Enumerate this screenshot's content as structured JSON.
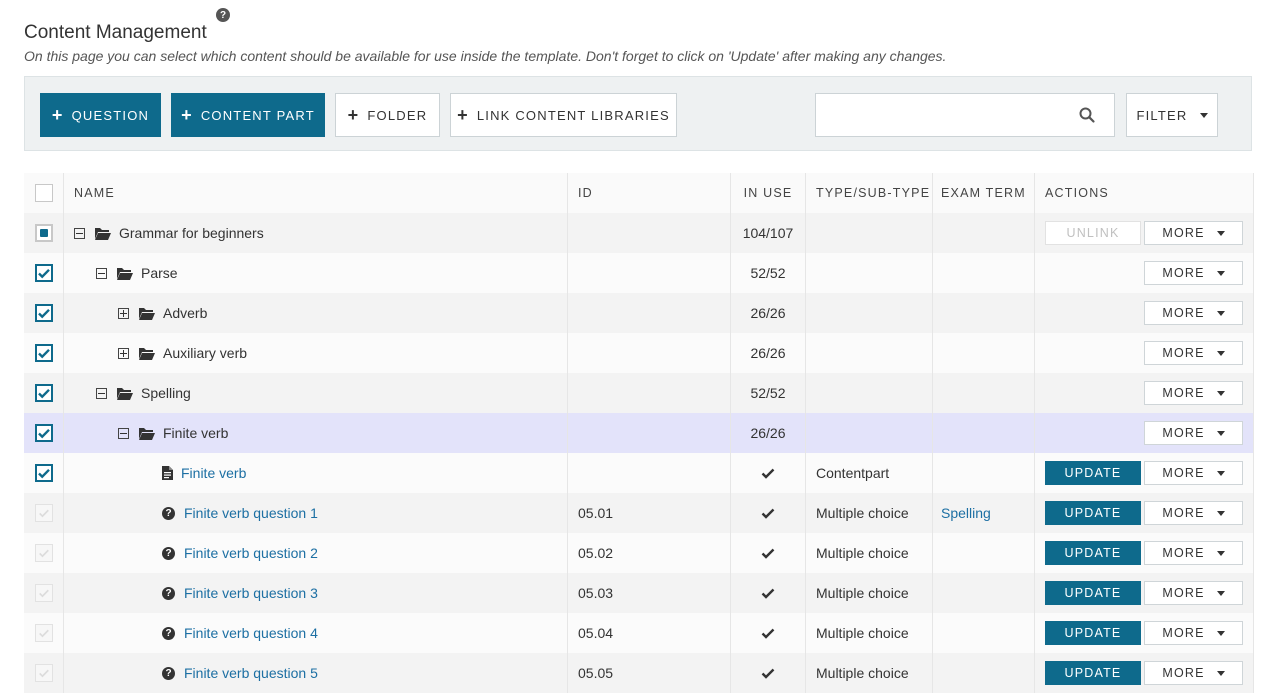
{
  "page": {
    "title": "Content Management",
    "help_symbol": "?",
    "subtitle": "On this page you can select which content should be available for use inside the template. Don't forget to click on 'Update' after making any changes."
  },
  "toolbar": {
    "question_label": "QUESTION",
    "content_part_label": "CONTENT PART",
    "folder_label": "FOLDER",
    "link_libraries_label": "LINK CONTENT LIBRARIES",
    "search_value": "",
    "search_placeholder": "",
    "filter_label": "FILTER",
    "accent_color": "#0e6a8c"
  },
  "table": {
    "columns": {
      "name": "NAME",
      "id": "ID",
      "in_use": "IN USE",
      "type": "TYPE/SUB-TYPE",
      "exam_term": "EXAM TERM",
      "actions": "ACTIONS"
    },
    "unlink_label": "UNLINK",
    "more_label": "MORE",
    "update_label": "UPDATE",
    "rows": [
      {
        "name": "Grammar for beginners",
        "id": "",
        "in_use": "104/107",
        "type": "",
        "term": ""
      },
      {
        "name": "Parse",
        "id": "",
        "in_use": "52/52",
        "type": "",
        "term": ""
      },
      {
        "name": "Adverb",
        "id": "",
        "in_use": "26/26",
        "type": "",
        "term": ""
      },
      {
        "name": "Auxiliary verb",
        "id": "",
        "in_use": "26/26",
        "type": "",
        "term": ""
      },
      {
        "name": "Spelling",
        "id": "",
        "in_use": "52/52",
        "type": "",
        "term": ""
      },
      {
        "name": "Finite verb",
        "id": "",
        "in_use": "26/26",
        "type": "",
        "term": ""
      },
      {
        "name": "Finite verb",
        "id": "",
        "in_use": "",
        "type": "Contentpart",
        "term": ""
      },
      {
        "name": "Finite verb question 1",
        "id": "05.01",
        "in_use": "",
        "type": "Multiple choice",
        "term": "Spelling"
      },
      {
        "name": "Finite verb question 2",
        "id": "05.02",
        "in_use": "",
        "type": "Multiple choice",
        "term": ""
      },
      {
        "name": "Finite verb question 3",
        "id": "05.03",
        "in_use": "",
        "type": "Multiple choice",
        "term": ""
      },
      {
        "name": "Finite verb question 4",
        "id": "05.04",
        "in_use": "",
        "type": "Multiple choice",
        "term": ""
      },
      {
        "name": "Finite verb question 5",
        "id": "05.05",
        "in_use": "",
        "type": "Multiple choice",
        "term": ""
      }
    ]
  }
}
